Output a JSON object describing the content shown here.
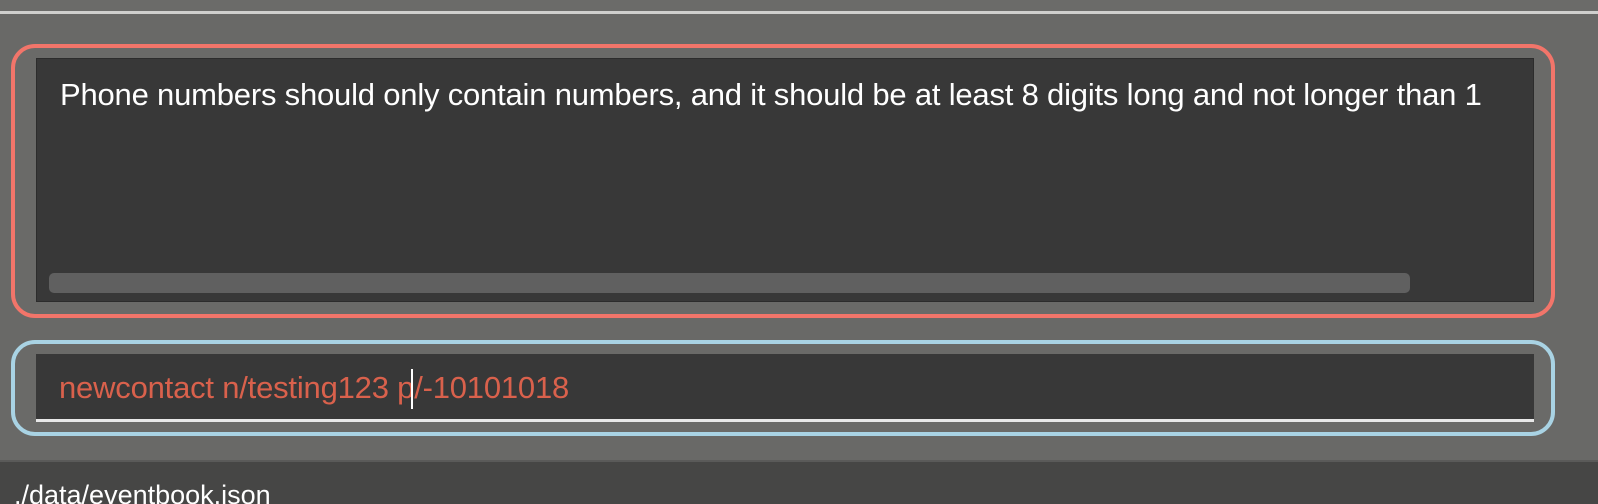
{
  "result_display": {
    "message": "Phone numbers should only contain numbers, and it should be at least 8 digits long and not longer than 1"
  },
  "command_box": {
    "value": "newcontact n/testing123 p/-10101018"
  },
  "status_bar": {
    "save_location": "./data/eventbook.json"
  },
  "colors": {
    "result_border": "#f2756a",
    "command_border": "#a9d3e4",
    "error_text": "#d9614c",
    "panel_background": "#383838",
    "window_background": "#696967"
  }
}
